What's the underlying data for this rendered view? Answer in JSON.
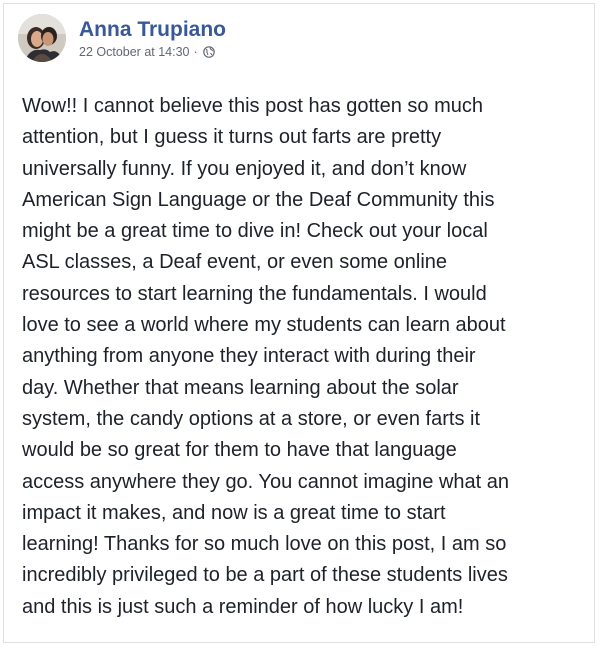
{
  "post": {
    "author": {
      "name": "Anna Trupiano",
      "avatar_icon": "profile-photo"
    },
    "timestamp": "22 October at 14:30",
    "separator": "·",
    "audience_icon": "globe-icon",
    "body": "Wow!! I cannot believe this post has gotten so much\nattention, but I guess it turns out farts are pretty\nuniversally funny. If you enjoyed it, and don’t know\nAmerican Sign Language or the Deaf Community this\nmight be a great time to dive in! Check out your local\nASL classes, a Deaf event, or even some online\nresources to start learning the fundamentals. I would\nlove to see a world where my students can learn about\nanything from anyone they interact with during their\nday. Whether that means learning about the solar\nsystem, the candy options at a store, or even farts it\nwould be so great for them to have that language\naccess anywhere they go. You cannot imagine what an\nimpact it makes, and now is a great time to start\nlearning! Thanks for so much love on this post, I am so\nincredibly privileged to be a part of these students lives\nand this is just such a reminder of how lucky I am!"
  },
  "colors": {
    "author_link": "#385898",
    "meta_text": "#616770",
    "body_text": "#1d2129",
    "card_border": "#dddfe2"
  }
}
